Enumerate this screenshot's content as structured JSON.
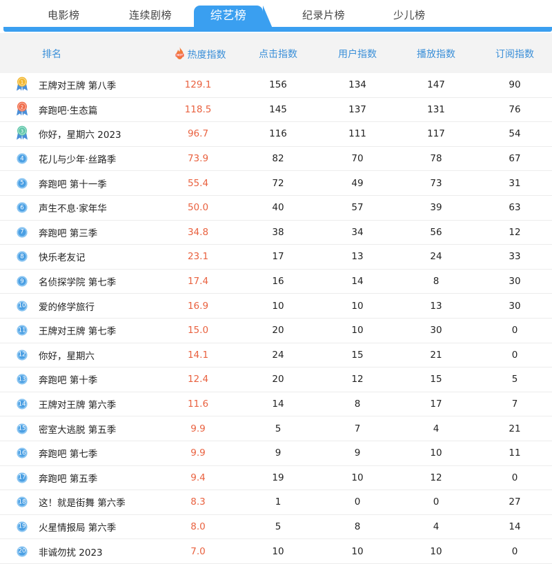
{
  "tabs": [
    {
      "label": "电影榜"
    },
    {
      "label": "连续剧榜"
    },
    {
      "label": "综艺榜"
    },
    {
      "label": "纪录片榜"
    },
    {
      "label": "少儿榜"
    }
  ],
  "active_tab": "综艺榜",
  "columns": {
    "rank": "排名",
    "heat": "热度指数",
    "clicks": "点击指数",
    "users": "用户指数",
    "plays": "播放指数",
    "subs": "订阅指数"
  },
  "colors": {
    "accent": "#3a9ff0",
    "heat_text": "#e9613f",
    "gold": "#f2b62c",
    "red": "#f06a48",
    "teal": "#5cc6a8"
  },
  "rows": [
    {
      "rank": "1",
      "name": "王牌对王牌 第八季",
      "heat": "129.1",
      "clicks": "156",
      "users": "134",
      "plays": "147",
      "subs": "90"
    },
    {
      "rank": "2",
      "name": "奔跑吧·生态篇",
      "heat": "118.5",
      "clicks": "145",
      "users": "137",
      "plays": "131",
      "subs": "76"
    },
    {
      "rank": "3",
      "name": "你好，星期六 2023",
      "heat": "96.7",
      "clicks": "116",
      "users": "111",
      "plays": "117",
      "subs": "54"
    },
    {
      "rank": "4",
      "name": "花儿与少年·丝路季",
      "heat": "73.9",
      "clicks": "82",
      "users": "70",
      "plays": "78",
      "subs": "67"
    },
    {
      "rank": "5",
      "name": "奔跑吧 第十一季",
      "heat": "55.4",
      "clicks": "72",
      "users": "49",
      "plays": "73",
      "subs": "31"
    },
    {
      "rank": "6",
      "name": "声生不息·家年华",
      "heat": "50.0",
      "clicks": "40",
      "users": "57",
      "plays": "39",
      "subs": "63"
    },
    {
      "rank": "7",
      "name": "奔跑吧 第三季",
      "heat": "34.8",
      "clicks": "38",
      "users": "34",
      "plays": "56",
      "subs": "12"
    },
    {
      "rank": "8",
      "name": "快乐老友记",
      "heat": "23.1",
      "clicks": "17",
      "users": "13",
      "plays": "24",
      "subs": "33"
    },
    {
      "rank": "9",
      "name": "名侦探学院 第七季",
      "heat": "17.4",
      "clicks": "16",
      "users": "14",
      "plays": "8",
      "subs": "30"
    },
    {
      "rank": "10",
      "name": "爱的修学旅行",
      "heat": "16.9",
      "clicks": "10",
      "users": "10",
      "plays": "13",
      "subs": "30"
    },
    {
      "rank": "11",
      "name": "王牌对王牌 第七季",
      "heat": "15.0",
      "clicks": "20",
      "users": "10",
      "plays": "30",
      "subs": "0"
    },
    {
      "rank": "12",
      "name": "你好，星期六",
      "heat": "14.1",
      "clicks": "24",
      "users": "15",
      "plays": "21",
      "subs": "0"
    },
    {
      "rank": "13",
      "name": "奔跑吧 第十季",
      "heat": "12.4",
      "clicks": "20",
      "users": "12",
      "plays": "15",
      "subs": "5"
    },
    {
      "rank": "14",
      "name": "王牌对王牌 第六季",
      "heat": "11.6",
      "clicks": "14",
      "users": "8",
      "plays": "17",
      "subs": "7"
    },
    {
      "rank": "15",
      "name": "密室大逃脱 第五季",
      "heat": "9.9",
      "clicks": "5",
      "users": "7",
      "plays": "4",
      "subs": "21"
    },
    {
      "rank": "16",
      "name": "奔跑吧 第七季",
      "heat": "9.9",
      "clicks": "9",
      "users": "9",
      "plays": "10",
      "subs": "11"
    },
    {
      "rank": "17",
      "name": "奔跑吧 第五季",
      "heat": "9.4",
      "clicks": "19",
      "users": "10",
      "plays": "12",
      "subs": "0"
    },
    {
      "rank": "18",
      "name": "这！就是街舞 第六季",
      "heat": "8.3",
      "clicks": "1",
      "users": "0",
      "plays": "0",
      "subs": "27"
    },
    {
      "rank": "19",
      "name": "火星情报局 第六季",
      "heat": "8.0",
      "clicks": "5",
      "users": "8",
      "plays": "4",
      "subs": "14"
    },
    {
      "rank": "20",
      "name": "非诚勿扰 2023",
      "heat": "7.0",
      "clicks": "10",
      "users": "10",
      "plays": "10",
      "subs": "0"
    }
  ]
}
